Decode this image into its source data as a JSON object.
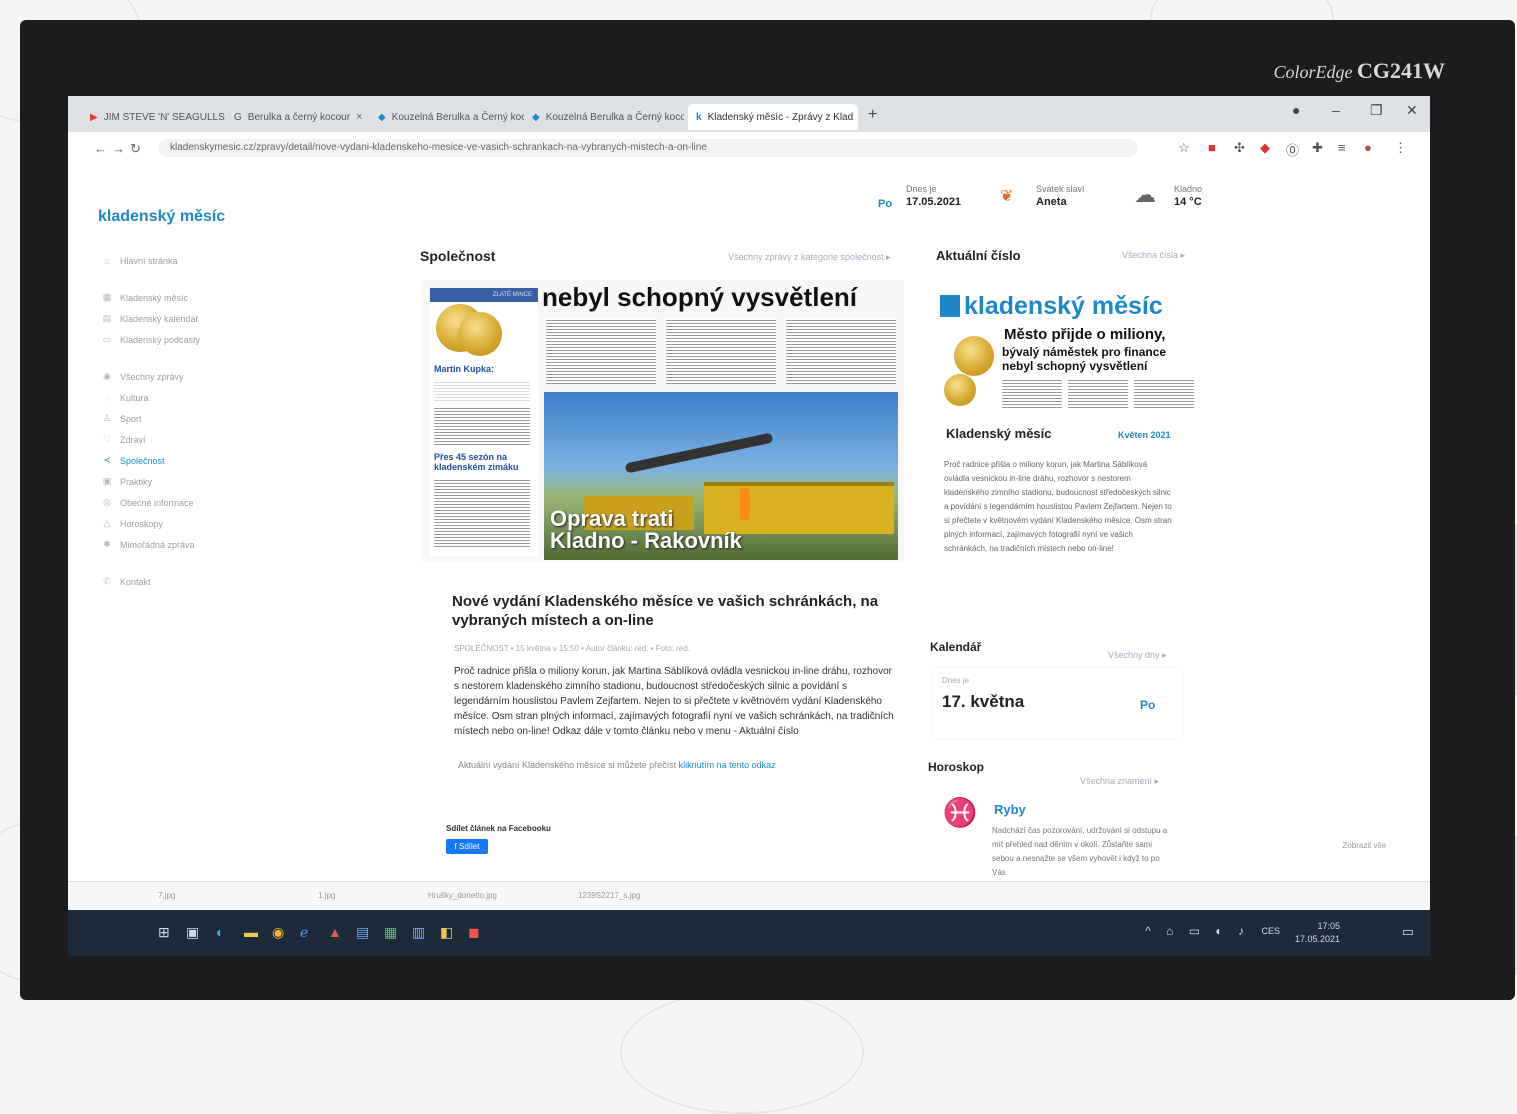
{
  "monitor": {
    "brand_script": "ColorEdge",
    "brand_model": "CG241W"
  },
  "browser": {
    "tabs": [
      {
        "label": "JIM STEVE 'N' SEAGULLS",
        "active": false
      },
      {
        "label": "Berulka a černý kocour",
        "active": false
      },
      {
        "label": "Kouzelná Berulka a Černý kocour",
        "active": false
      },
      {
        "label": "Kouzelná Berulka a Černý kocour",
        "active": false
      },
      {
        "label": "Kladenský měsíc - Zprávy z Klad",
        "active": true
      }
    ],
    "new_tab": "+",
    "url": "kladenskymesic.cz/zpravy/detail/nove-vydani-kladenskeho-mesice-ve-vasich-schrankach-na-vybranych-mistech-a-on-line"
  },
  "site": {
    "logo": "kladenský měsíc",
    "topbar": {
      "day_abbr": "Po",
      "today_label": "Dnes je",
      "today_value": "17.05.2021",
      "nameday_label": "Svátek slaví",
      "nameday_value": "Aneta",
      "weather_city": "Kladno",
      "weather_temp": "14 °C"
    },
    "sidebar": [
      {
        "label": "Hlavní stránka",
        "icon": "home-icon",
        "active": false
      },
      {
        "label": "Kladenský měsíc",
        "icon": "grid-icon",
        "active": false
      },
      {
        "label": "Kladenský kalendář",
        "icon": "calendar-icon",
        "active": false
      },
      {
        "label": "Kladenský podcasty",
        "icon": "podcast-icon",
        "active": false
      },
      {
        "label": "Všechny zprávy",
        "icon": "news-icon",
        "active": false
      },
      {
        "label": "Kultura",
        "icon": "culture-icon",
        "active": false
      },
      {
        "label": "Sport",
        "icon": "sport-icon",
        "active": false
      },
      {
        "label": "Zdraví",
        "icon": "health-icon",
        "active": false
      },
      {
        "label": "Společnost",
        "icon": "share-icon",
        "active": true
      },
      {
        "label": "Praktiky",
        "icon": "tips-icon",
        "active": false
      },
      {
        "label": "Obecné informace",
        "icon": "info-icon",
        "active": false
      },
      {
        "label": "Horoskopy",
        "icon": "horoscope-icon",
        "active": false
      },
      {
        "label": "Mimořádná zpráva",
        "icon": "alert-icon",
        "active": false
      },
      {
        "label": "Kontakt",
        "icon": "contact-icon",
        "active": false
      }
    ],
    "main": {
      "section_title": "Společnost",
      "section_link": "Všechny zprávy z kategorie společnost",
      "magazine": {
        "banner": "ZLATÉ MINCE",
        "headline": "nebyl schopný vysvětlení",
        "name": "Martin Kupka:",
        "side_headline": "Přes 45 sezón na kladenském zimáku",
        "photo_caption_1": "Oprava trati",
        "photo_caption_2": "Kladno - Rakovník"
      },
      "article_title": "Nové vydání Kladenského měsíce ve vašich schránkách, na vybraných místech a on-line",
      "meta": "SPOLEČNOST • 15 května v 15:50 • Autor článku: red. • Foto: red.",
      "body": "Proč radnice přišla o miliony korun, jak Martina Sáblíková ovládla vesnickou in-line dráhu, rozhovor s nestorem kladenského zimního stadionu, budoucnost středočeských silnic a povídání s legendárním houslistou Pavlem Zejfartem. Nejen to si přečtete v květnovém vydání Kladenského měsíce. Osm stran plných informací, zajímavých fotografií nyní ve vašich schránkách, na tradičních místech nebo on-line! Odkaz dále v tomto článku nebo v menu - Aktuální číslo",
      "body_note_prefix": "Aktuální vydání Kladenského měsíce si můžete přečíst ",
      "body_note_link": "kliknutím na tento odkaz",
      "share_label": "Sdílet článek na Facebooku",
      "share_button": "Sdílet"
    },
    "right": {
      "issue_title": "Aktuální číslo",
      "issue_link": "Všechna čísla",
      "cover_logo": "kladenský měsíc",
      "cover_line1": "Město přijde o miliony,",
      "cover_line2": "bývalý náměstek pro finance",
      "cover_line3": "nebyl schopný vysvětlení",
      "card_title": "Kladenský měsíc",
      "card_date": "Květen 2021",
      "card_text": "Proč radnice přišla o miliony korun, jak Martina Sáblíková ovládla vesnickou in-line dráhu, rozhovor s nestorem kladenského zimního stadionu, budoucnost středočeských silnic a povídání s legendárním houslistou Pavlem Zejfartem. Nejen to si přečtete v květnovém vydání Kladenského měsíce. Osm stran plných informací, zajímavých fotografií nyní ve vašich schránkách, na tradičních místech nebo on-line!",
      "calendar_title": "Kalendář",
      "calendar_link": "Všechny dny",
      "calendar_small": "Dnes je",
      "calendar_day": "17. května",
      "calendar_weekday": "Po",
      "horoscope_title": "Horoskop",
      "horoscope_link": "Všechna znamení",
      "horoscope_sign": "Ryby",
      "horoscope_text": "Nadchází čas pozorování, udržování si odstupu a mít přehled nad děním v okolí. Zůstaňte sami sebou a nesnažte se všem vyhovět i když to po Vás"
    }
  },
  "downloads": [
    {
      "name": "7.jpg"
    },
    {
      "name": "1.jpg"
    },
    {
      "name": "Hrušky_donetto.jpg"
    },
    {
      "name": "1239S2217_s.jpg"
    }
  ],
  "toast": "Zobrazit vše",
  "taskbar": {
    "lang": "CES",
    "time": "17:05",
    "date": "17.05.2021"
  }
}
